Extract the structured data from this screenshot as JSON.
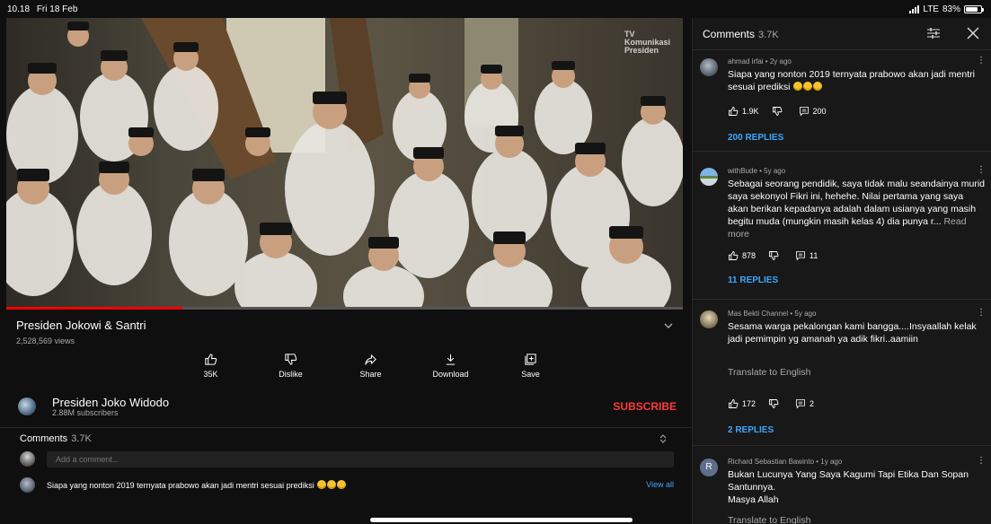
{
  "status_bar": {
    "time": "10.18",
    "date": "Fri 18 Feb",
    "network": "LTE",
    "battery": "83%",
    "battery_level": 0.83
  },
  "video": {
    "title": "Presiden Jokowi & Santri",
    "views": "2,528,569 views",
    "watermark": "TV\nKomunikasi\nPresiden",
    "progress": 0.26
  },
  "actions": [
    {
      "name": "like",
      "label": "35K",
      "icon": "thumbs-up-icon"
    },
    {
      "name": "dislike",
      "label": "Dislike",
      "icon": "thumbs-down-icon"
    },
    {
      "name": "share",
      "label": "Share",
      "icon": "share-icon"
    },
    {
      "name": "download",
      "label": "Download",
      "icon": "download-icon"
    },
    {
      "name": "save",
      "label": "Save",
      "icon": "save-icon"
    }
  ],
  "channel": {
    "name": "Presiden Joko Widodo",
    "subscribers": "2.88M subscribers",
    "subscribe_label": "SUBSCRIBE"
  },
  "comments_section": {
    "label": "Comments",
    "count": "3.7K",
    "add_placeholder": "Add a comment...",
    "first_comment": "Siapa yang nonton 2019 ternyata prabowo akan jadi mentri sesuai prediksi",
    "view_all": "View all"
  },
  "panel": {
    "title": "Comments",
    "count": "3.7K",
    "comments": [
      {
        "author": "ahmad irfai • 2y ago",
        "text": "Siapa yang nonton 2019 ternyata prabowo akan jadi mentri sesuai prediksi",
        "likes": "1.9K",
        "reply_count": "200",
        "replies_label": "200 REPLIES"
      },
      {
        "author": "withBude • 5y ago",
        "text": "Sebagai seorang pendidik, saya tidak malu seandainya murid saya sekonyol Fikri ini, hehehe. Nilai pertama yang saya akan berikan kepadanya adalah dalam usianya yang masih begitu muda (mungkin masih kelas 4) dia punya r...",
        "read_more": "Read more",
        "likes": "878",
        "reply_count": "11",
        "replies_label": "11 REPLIES"
      },
      {
        "author": "Mas Bekti Channel • 5y ago",
        "text": "Sesama warga pekalongan kami bangga....Insyaallah kelak jadi pemimpin yg amanah ya adik fikri..aamiin",
        "translate": "Translate to English",
        "likes": "172",
        "reply_count": "2",
        "replies_label": "2 REPLIES"
      },
      {
        "author": "Richard Sebastian Bawinto • 1y ago",
        "avatar_letter": "R",
        "text_line1": "Bukan Lucunya Yang Saya Kagumi Tapi Etika Dan Sopan Santunnya.",
        "text_line2": "Masya Allah",
        "translate": "Translate to English"
      }
    ]
  },
  "colors": {
    "accent_red": "#ff3b3b",
    "link_blue": "#3ea6ff",
    "background": "#0f0f0f",
    "panel": "#181818"
  }
}
